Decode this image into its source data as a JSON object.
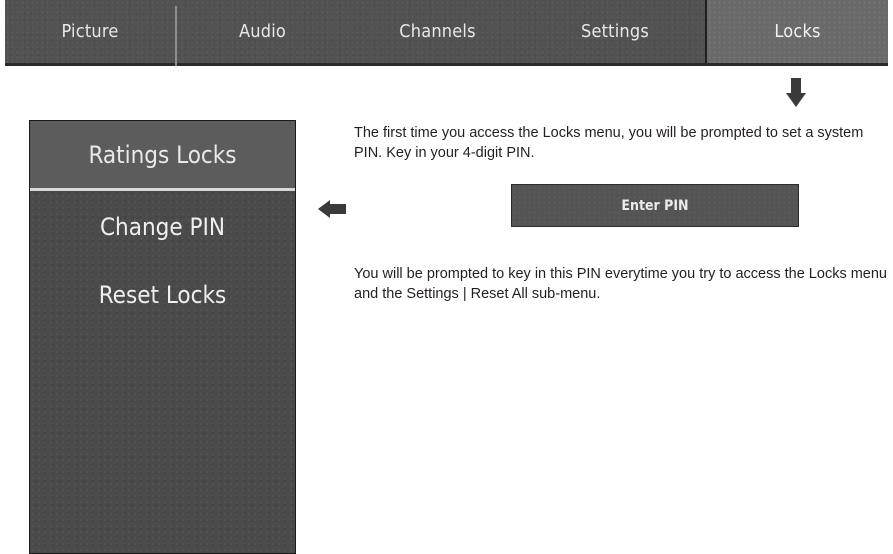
{
  "tabs": [
    {
      "label": "Picture"
    },
    {
      "label": "Audio"
    },
    {
      "label": "Channels"
    },
    {
      "label": "Settings"
    },
    {
      "label": "Locks",
      "active": true
    }
  ],
  "locks_menu": {
    "header": "Ratings Locks",
    "items": [
      {
        "label": "Change PIN"
      },
      {
        "label": "Reset Locks"
      }
    ]
  },
  "instructions": {
    "first_paragraph": "The first time you access the Locks menu, you will be prompted to set a system PIN. Key in your 4-digit PIN.",
    "pin_field_label": "Enter PIN",
    "second_paragraph": "You will be prompted to key in this PIN everytime you try to access the Locks menu and the Settings | Reset All sub-menu."
  },
  "icons": {
    "down_arrow": "arrow-down-icon",
    "left_arrow": "arrow-left-icon"
  },
  "colors": {
    "menu_background": "#4a4a4a",
    "active_tab": "#6a6a6a",
    "text_dark": "#231f20"
  }
}
